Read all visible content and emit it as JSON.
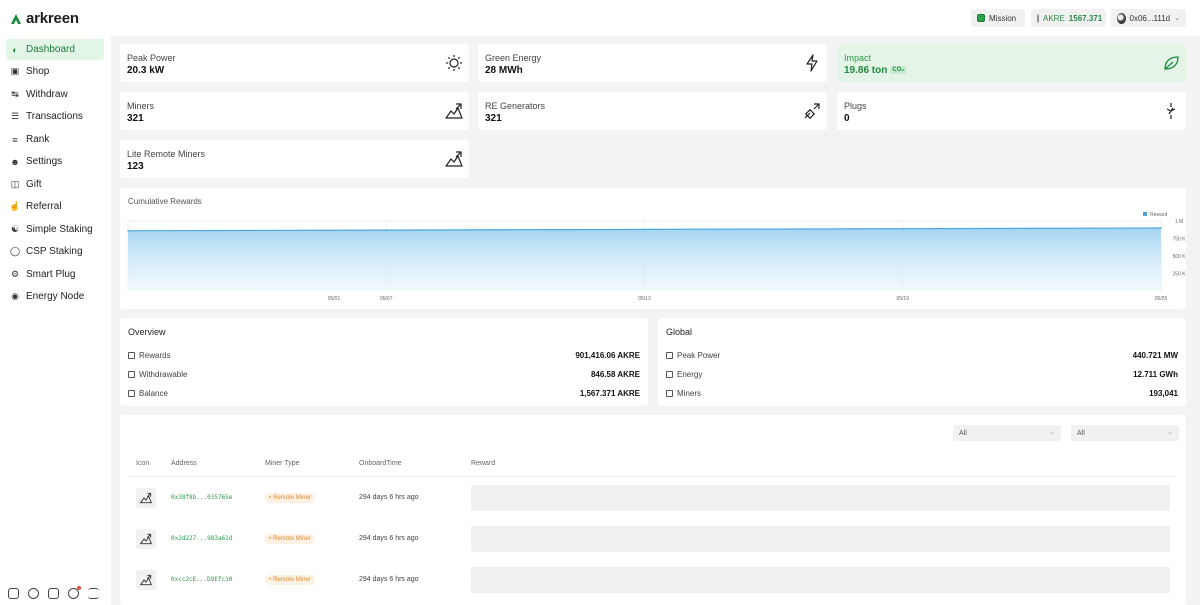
{
  "header": {
    "brand": "arkreen",
    "mission_label": "Mission",
    "akre_label": "AKRE",
    "akre_balance": "1567.371",
    "wallet_address": "0x06...111d",
    "accent_color": "#2a8b45"
  },
  "sidebar": {
    "items": [
      {
        "label": "Dashboard",
        "icon": "gauge-icon",
        "active": true
      },
      {
        "label": "Shop",
        "icon": "shop-icon",
        "active": false
      },
      {
        "label": "Withdraw",
        "icon": "withdraw-icon",
        "active": false
      },
      {
        "label": "Transactions",
        "icon": "coins-icon",
        "active": false
      },
      {
        "label": "Rank",
        "icon": "list-icon",
        "active": false
      },
      {
        "label": "Settings",
        "icon": "user-settings-icon",
        "active": false
      },
      {
        "label": "Gift",
        "icon": "gift-icon",
        "active": false
      },
      {
        "label": "Referral",
        "icon": "thumbs-up-icon",
        "active": false
      },
      {
        "label": "Simple Staking",
        "icon": "staking-icon",
        "active": false
      },
      {
        "label": "CSP Staking",
        "icon": "csp-staking-icon",
        "active": false
      },
      {
        "label": "Smart Plug",
        "icon": "plug-icon",
        "active": false
      },
      {
        "label": "Energy Node",
        "icon": "energy-node-icon",
        "active": false
      }
    ],
    "footer_icons": [
      "home-icon",
      "discord-icon",
      "document-icon",
      "notification-icon",
      "menu-icon"
    ]
  },
  "stats": {
    "peak_power": {
      "title": "Peak Power",
      "value": "20.3 kW",
      "icon": "sun-icon"
    },
    "green_energy": {
      "title": "Green Energy",
      "value": "28 MWh",
      "icon": "bolt-icon"
    },
    "impact": {
      "title": "Impact",
      "value": "19.86 ton",
      "unit_badge": "CO₂",
      "icon": "leaf-icon"
    },
    "miners": {
      "title": "Miners",
      "value": "321",
      "icon": "miner-icon"
    },
    "re_generators": {
      "title": "RE Generators",
      "value": "321",
      "icon": "generator-icon"
    },
    "plugs": {
      "title": "Plugs",
      "value": "0",
      "icon": "plug-icon"
    },
    "lite_remote_miners": {
      "title": "Lite Remote Miners",
      "value": "123",
      "icon": "miner-icon"
    }
  },
  "chart_data": {
    "type": "area",
    "title": "Cumulative Rewards",
    "x": [
      "05/01",
      "05/07",
      "05/13",
      "05/19",
      "05/25"
    ],
    "y_tick_labels": [
      "250 K",
      "500 K",
      "750 K",
      "1 M"
    ],
    "series": [
      {
        "name": "Reward",
        "values": [
          860000,
          870000,
          880000,
          890000,
          900000
        ]
      }
    ],
    "ylim": [
      0,
      1000000
    ],
    "legend": "top-right",
    "grid": true,
    "color": "#4aa6e0"
  },
  "overview": {
    "title": "Overview",
    "rows": [
      {
        "label": "Rewards",
        "value": "901,416.06 AKRE",
        "icon": "dollar-icon"
      },
      {
        "label": "Withdrawable",
        "value": "846.58 AKRE",
        "icon": "withdraw-icon"
      },
      {
        "label": "Balance",
        "value": "1,567.371 AKRE",
        "icon": "wallet-icon"
      }
    ]
  },
  "global": {
    "title": "Global",
    "rows": [
      {
        "label": "Peak Power",
        "value": "440.721 MW",
        "icon": "peak-icon"
      },
      {
        "label": "Energy",
        "value": "12.711 GWh",
        "icon": "bolt-icon"
      },
      {
        "label": "Miners",
        "value": "193,041",
        "icon": "miner-icon"
      }
    ]
  },
  "table": {
    "filters": [
      "All",
      "All"
    ],
    "columns": [
      "Icon",
      "Address",
      "Miner Type",
      "OnboardTime",
      "Reward"
    ],
    "rows": [
      {
        "address": "0x38f8b...035765e",
        "type": "Remote Miner",
        "time": "294 days 6 hrs ago"
      },
      {
        "address": "0x2d227...983a61d",
        "type": "Remote Miner",
        "time": "294 days 6 hrs ago"
      },
      {
        "address": "0xcc2cE...D9Efc10",
        "type": "Remote Miner",
        "time": "294 days 6 hrs ago"
      }
    ]
  }
}
